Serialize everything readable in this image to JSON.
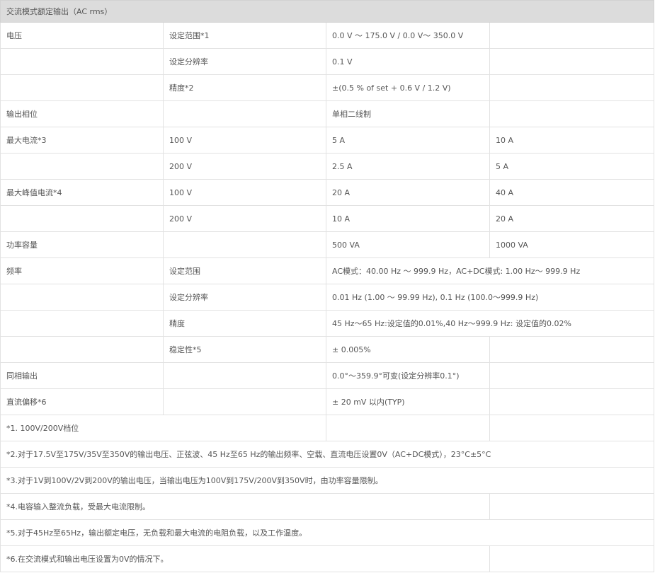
{
  "header": "交流模式额定输出（AC rms）",
  "rows": [
    {
      "c1": "电压",
      "c2": "设定范围*1",
      "c3": "0.0 V ～ 175.0 V / 0.0 V～ 350.0 V",
      "c4": ""
    },
    {
      "c1": "",
      "c2": "设定分辨率",
      "c3": "0.1 V",
      "c4": ""
    },
    {
      "c1": "",
      "c2": "精度*2",
      "c3": "±(0.5 % of set + 0.6 V / 1.2 V)",
      "c4": ""
    },
    {
      "c1": "输出相位",
      "c2": "",
      "c3": "单相二线制",
      "c4": ""
    },
    {
      "c1": "最大电流*3",
      "c2": "100 V",
      "c3": "5 A",
      "c4": "10 A"
    },
    {
      "c1": "",
      "c2": "200 V",
      "c3": "2.5 A",
      "c4": "5 A"
    },
    {
      "c1": "最大峰值电流*4",
      "c2": "100 V",
      "c3": "20 A",
      "c4": "40 A"
    },
    {
      "c1": "",
      "c2": "200 V",
      "c3": "10 A",
      "c4": "20 A"
    },
    {
      "c1": "功率容量",
      "c2": "",
      "c3": "500 VA",
      "c4": "1000 VA"
    },
    {
      "c1": "频率",
      "c2": "设定范围",
      "c34": "AC模式：40.00 Hz ～ 999.9 Hz，AC+DC模式: 1.00 Hz～ 999.9 Hz"
    },
    {
      "c1": "",
      "c2": "设定分辨率",
      "c34": "0.01 Hz (1.00 ～ 99.99 Hz), 0.1 Hz (100.0～999.9 Hz)"
    },
    {
      "c1": "",
      "c2": "精度",
      "c34": "45 Hz～65 Hz:设定值的0.01%,40 Hz～999.9 Hz: 设定值的0.02%"
    },
    {
      "c1": "",
      "c2": "稳定性*5",
      "c3": "± 0.005%",
      "c4": ""
    },
    {
      "c1": "同相输出",
      "c2": "",
      "c3": "0.0°～359.9°可变(设定分辨率0.1°)",
      "c4": ""
    },
    {
      "c1": "直流偏移*6",
      "c2": "",
      "c3": "± 20 mV 以内(TYP)",
      "c4": ""
    }
  ],
  "notes": {
    "n1": "*1. 100V/200V档位",
    "n2": "*2.对于17.5V至175V/35V至350V的输出电压、正弦波、45 Hz至65 Hz的输出频率、空载、直流电压设置0V（AC+DC模式），23°C±5°C",
    "n3": "*3.对于1V到100V/2V到200V的输出电压，当输出电压为100V到175V/200V到350V时，由功率容量限制。",
    "n4": "*4.电容输入整流负载，受最大电流限制。",
    "n5": "*5.对于45Hz至65Hz，输出额定电压，无负载和最大电流的电阻负载，以及工作温度。",
    "n6": "*6.在交流模式和输出电压设置为0V的情况下。"
  }
}
